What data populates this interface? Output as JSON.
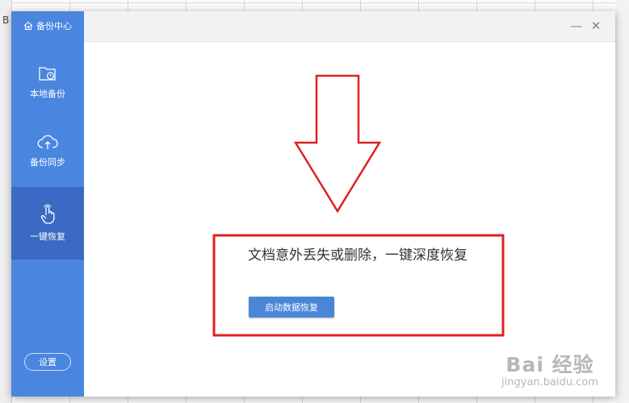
{
  "spreadsheet": {
    "cell_label": "B"
  },
  "app": {
    "title": "备份中心"
  },
  "sidebar": {
    "items": [
      {
        "label": "本地备份",
        "icon": "folder-clock-icon"
      },
      {
        "label": "备份同步",
        "icon": "cloud-upload-icon"
      },
      {
        "label": "一键恢复",
        "icon": "hand-tap-icon",
        "active": true
      }
    ],
    "settings_label": "设置"
  },
  "window_controls": {
    "minimize": "—",
    "close": "✕"
  },
  "main": {
    "headline": "文档意外丢失或删除，一键深度恢复",
    "start_button": "启动数据恢复"
  },
  "watermark": {
    "brand": "Bai  经验",
    "url": "jingyan.baidu.com"
  },
  "colors": {
    "sidebar": "#4a86e0",
    "sidebar_active": "#3a6ac3",
    "button": "#4a86d8",
    "annotation_red": "#e02020"
  }
}
